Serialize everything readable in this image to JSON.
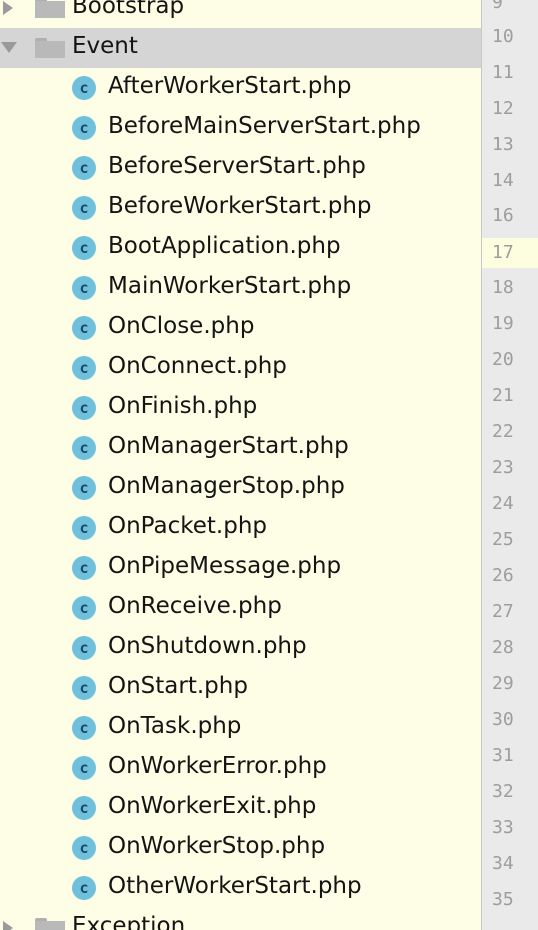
{
  "tree": {
    "top_folder": {
      "label": "Bootstrap"
    },
    "open_folder": {
      "label": "Event"
    },
    "files": [
      "AfterWorkerStart.php",
      "BeforeMainServerStart.php",
      "BeforeServerStart.php",
      "BeforeWorkerStart.php",
      "BootApplication.php",
      "MainWorkerStart.php",
      "OnClose.php",
      "OnConnect.php",
      "OnFinish.php",
      "OnManagerStart.php",
      "OnManagerStop.php",
      "OnPacket.php",
      "OnPipeMessage.php",
      "OnReceive.php",
      "OnShutdown.php",
      "OnStart.php",
      "OnTask.php",
      "OnWorkerError.php",
      "OnWorkerExit.php",
      "OnWorkerStop.php",
      "OtherWorkerStart.php"
    ],
    "bottom_folder": {
      "label": "Exception"
    },
    "class_glyph": "c"
  },
  "gutter": {
    "line_numbers": [
      "9",
      "10",
      "11",
      "12",
      "13",
      "14",
      "16",
      "17",
      "18",
      "19",
      "20",
      "21",
      "22",
      "23",
      "24",
      "25",
      "26",
      "27",
      "28",
      "29",
      "30",
      "31",
      "32",
      "33",
      "34",
      "35"
    ],
    "current_line": "17"
  },
  "colors": {
    "tree_bg": "#fefee6",
    "selected_row": "#d5d5d5",
    "class_icon": "#6fc0dd",
    "gutter_bg": "#eaeaea"
  }
}
